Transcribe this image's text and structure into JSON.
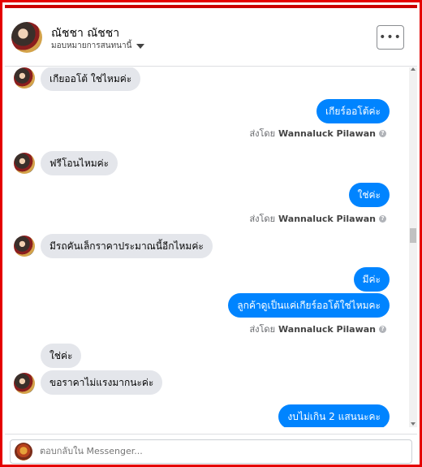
{
  "header": {
    "name": "ณัชชา ณัชชา",
    "subtitle": "มอบหมายการสนทนานี้"
  },
  "messages": [
    {
      "dir": "in",
      "text": "เกียออโต้ ใช่ไหมค่ะ"
    },
    {
      "dir": "out",
      "text": "เกียร์ออโต้ค่ะ"
    },
    {
      "dir": "sent",
      "prefix": "ส่งโดย",
      "name": "Wannaluck Pilawan"
    },
    {
      "dir": "in",
      "text": "ฟรีโอนไหมค่ะ"
    },
    {
      "dir": "out",
      "text": "ใช่ค่ะ"
    },
    {
      "dir": "sent",
      "prefix": "ส่งโดย",
      "name": "Wannaluck Pilawan"
    },
    {
      "dir": "in",
      "text": "มีรถคันเล็กราคาประมาณนี้อีกไหมค่ะ"
    },
    {
      "dir": "out",
      "text": "มีค่ะ"
    },
    {
      "dir": "out",
      "text": "ลูกค้าดูเป็นแค่เกียร์ออโต้ใช่ไหมคะ"
    },
    {
      "dir": "sent",
      "prefix": "ส่งโดย",
      "name": "Wannaluck Pilawan"
    },
    {
      "dir": "in",
      "text": "ใช่ค่ะ"
    },
    {
      "dir": "in",
      "text": "ขอราคาไม่แรงมากนะค่ะ"
    },
    {
      "dir": "out",
      "text": "งบไม่เกิน 2 แสนนะคะ"
    }
  ],
  "composer": {
    "placeholder": "ตอบกลับใน Messenger..."
  },
  "colors": {
    "outgoing": "#0084ff",
    "incoming": "#e4e6eb",
    "frame": "#e50000"
  },
  "icons": {
    "more": "more-icon",
    "info": "info-icon",
    "caret": "caret-down-icon"
  }
}
